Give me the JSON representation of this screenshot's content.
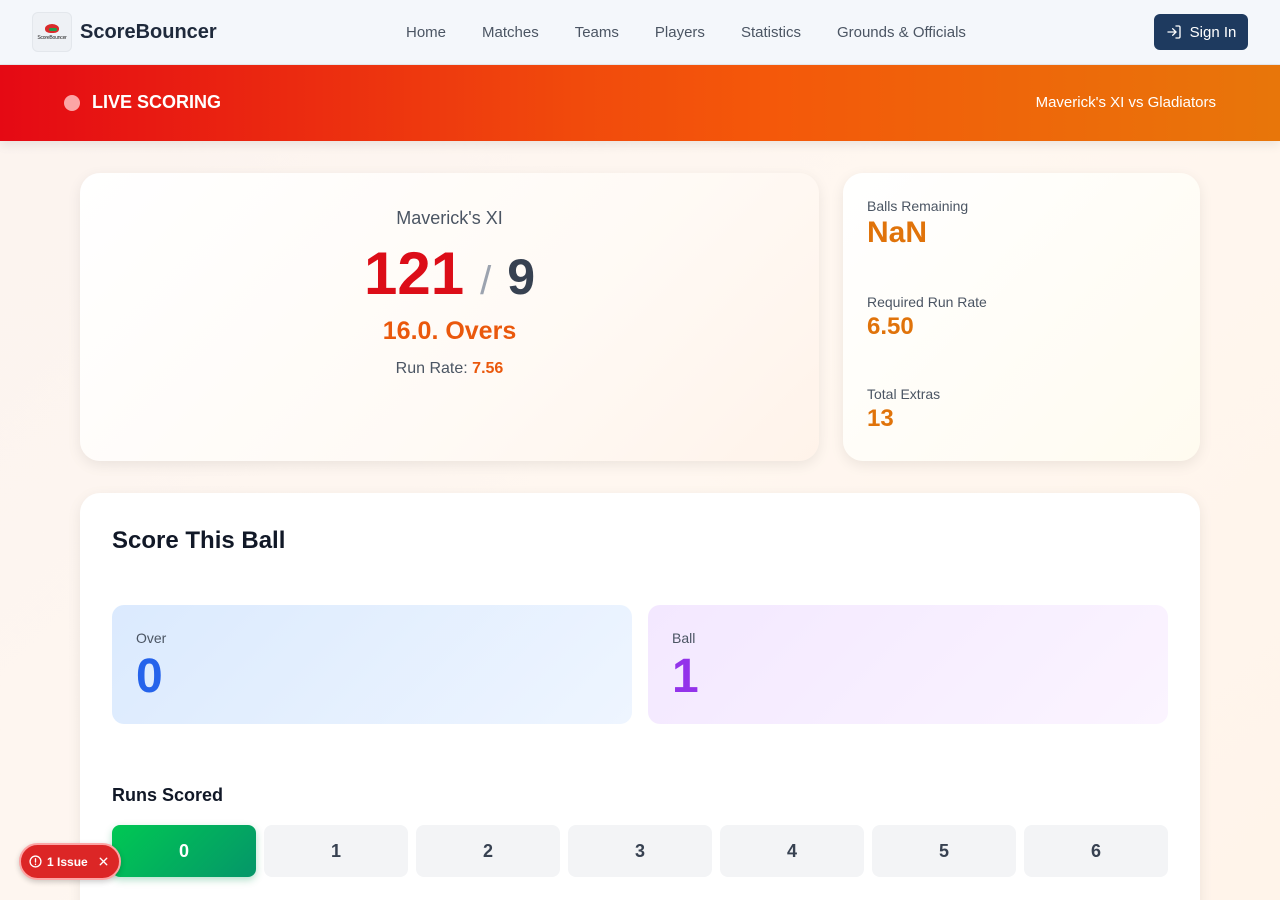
{
  "brand": {
    "name": "ScoreBouncer",
    "logo_text": "ScoreBouncer"
  },
  "nav": [
    "Home",
    "Matches",
    "Teams",
    "Players",
    "Statistics",
    "Grounds & Officials"
  ],
  "header": {
    "signin_label": "Sign In"
  },
  "live": {
    "label": "LIVE SCORING",
    "match": "Maverick's XI vs Gladiators"
  },
  "score": {
    "team": "Maverick's XI",
    "runs": "121",
    "slash": "/",
    "wickets": "9",
    "overs": "16.0. Overs",
    "run_rate_label": "Run Rate:",
    "run_rate": "7.56"
  },
  "stats": {
    "balls_remaining_label": "Balls Remaining",
    "balls_remaining": "NaN",
    "required_rr_label": "Required Run Rate",
    "required_rr": "6.50",
    "extras_label": "Total Extras",
    "extras": "13"
  },
  "ball_entry": {
    "title": "Score This Ball",
    "over_label": "Over",
    "over": "0",
    "ball_label": "Ball",
    "ball": "1",
    "runs_title": "Runs Scored",
    "runs_options": [
      "0",
      "1",
      "2",
      "3",
      "4",
      "5",
      "6"
    ],
    "selected_run": "0"
  },
  "issue": {
    "label": "1 Issue"
  },
  "colors": {
    "accent": "#ea580c",
    "live": "#e50914",
    "nav_button": "#1e3a5f",
    "selected": "#00c853"
  }
}
